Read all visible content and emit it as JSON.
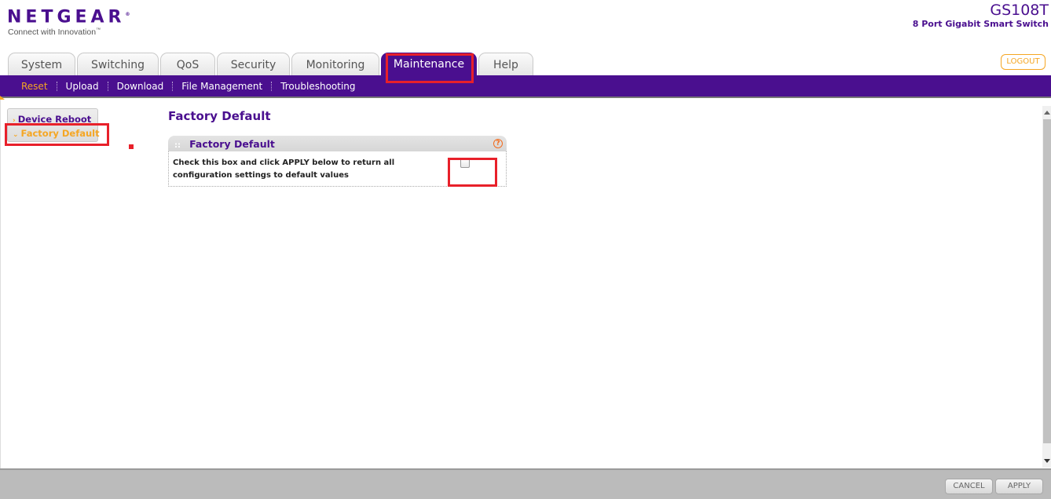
{
  "header": {
    "brand": "NETGEAR",
    "brand_mark": "®",
    "tagline": "Connect with Innovation",
    "tagline_mark": "™",
    "model": "GS108T",
    "model_description": "8 Port Gigabit Smart Switch",
    "logout_label": "LOGOUT"
  },
  "tabs": [
    {
      "label": "System",
      "active": false
    },
    {
      "label": "Switching",
      "active": false
    },
    {
      "label": "QoS",
      "active": false
    },
    {
      "label": "Security",
      "active": false
    },
    {
      "label": "Monitoring",
      "active": false
    },
    {
      "label": "Maintenance",
      "active": true
    },
    {
      "label": "Help",
      "active": false
    }
  ],
  "subnav": [
    {
      "label": "Reset",
      "active": true
    },
    {
      "label": "Upload",
      "active": false
    },
    {
      "label": "Download",
      "active": false
    },
    {
      "label": "File Management",
      "active": false
    },
    {
      "label": "Troubleshooting",
      "active": false
    }
  ],
  "leftmenu": [
    {
      "label": "Device Reboot",
      "active": false,
      "icon": "chevron-right-icon"
    },
    {
      "label": "Factory Default",
      "active": true,
      "icon": "chevron-down-icon"
    }
  ],
  "page": {
    "title": "Factory Default",
    "panel": {
      "title": "Factory Default",
      "grip_glyph": "::",
      "help_glyph": "?",
      "description": "Check this box and click APPLY below to return all configuration settings to default values",
      "checkbox_checked": false
    }
  },
  "footer": {
    "cancel_label": "CANCEL",
    "apply_label": "APPLY"
  },
  "colors": {
    "brand_purple": "#4a0f8f",
    "accent_orange": "#f5a623",
    "highlight_red": "#e8202a"
  }
}
